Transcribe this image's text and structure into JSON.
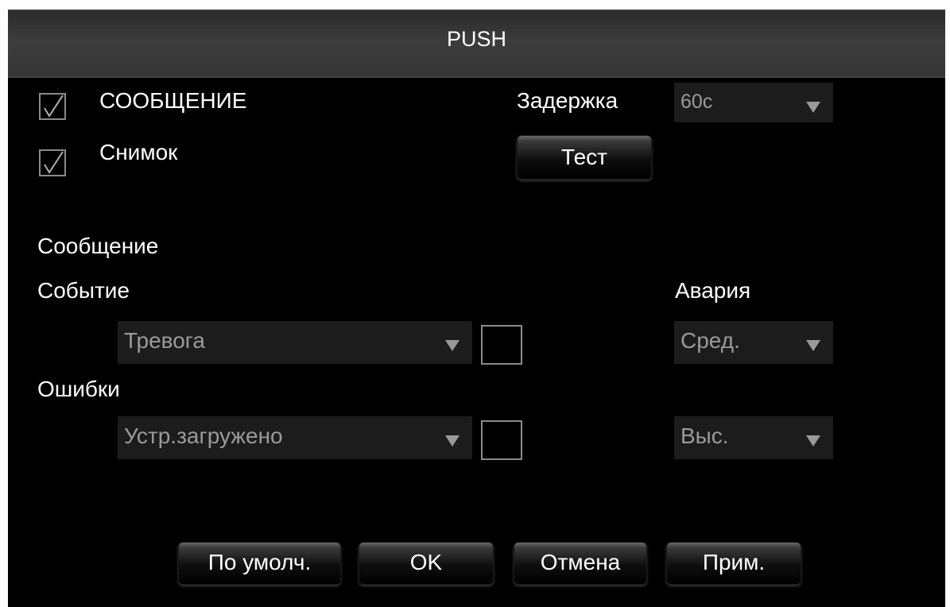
{
  "dialog": {
    "title": "PUSH"
  },
  "options": {
    "message_label": "СООБЩЕНИЕ",
    "message_checked": true,
    "snapshot_label": "Снимок",
    "snapshot_checked": true,
    "delay_label": "Задержка",
    "delay_value": "60c",
    "test_button": "Тест"
  },
  "section": {
    "heading": "Сообщение",
    "event_label": "Событие",
    "alarm_label": "Авария",
    "event_type_value": "Тревога",
    "event_enabled": false,
    "event_level_value": "Сред.",
    "errors_label": "Ошибки",
    "error_type_value": "Устр.загружено",
    "error_enabled": false,
    "error_level_value": "Выс."
  },
  "footer": {
    "default_button": "По умолч.",
    "ok_button": "OK",
    "cancel_button": "Отмена",
    "apply_button": "Прим."
  },
  "icons": {
    "checkmark": "checkmark-icon",
    "dropdown": "triangle-down-icon"
  },
  "colors": {
    "background": "#000000",
    "titlebar": "#3c3c3c",
    "text": "#ffffff",
    "field_text": "#9a9a9a",
    "field_bg": "#1c1c1c"
  }
}
